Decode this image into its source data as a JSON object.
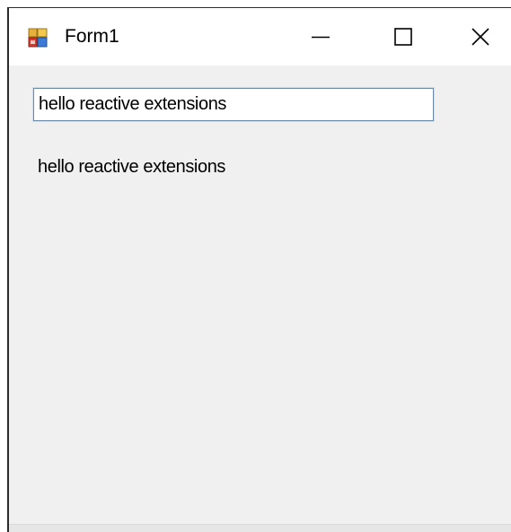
{
  "window": {
    "title": "Form1",
    "icon": "winforms-app-icon"
  },
  "caption_buttons": {
    "minimize_icon": "minimize-icon",
    "maximize_icon": "maximize-icon",
    "close_icon": "close-icon"
  },
  "form": {
    "input_value": "hello reactive extensions",
    "label_text": "hello reactive extensions"
  },
  "colors": {
    "client_background": "#f0f0f0",
    "titlebar_background": "#ffffff",
    "input_border": "#6a8aa8"
  }
}
